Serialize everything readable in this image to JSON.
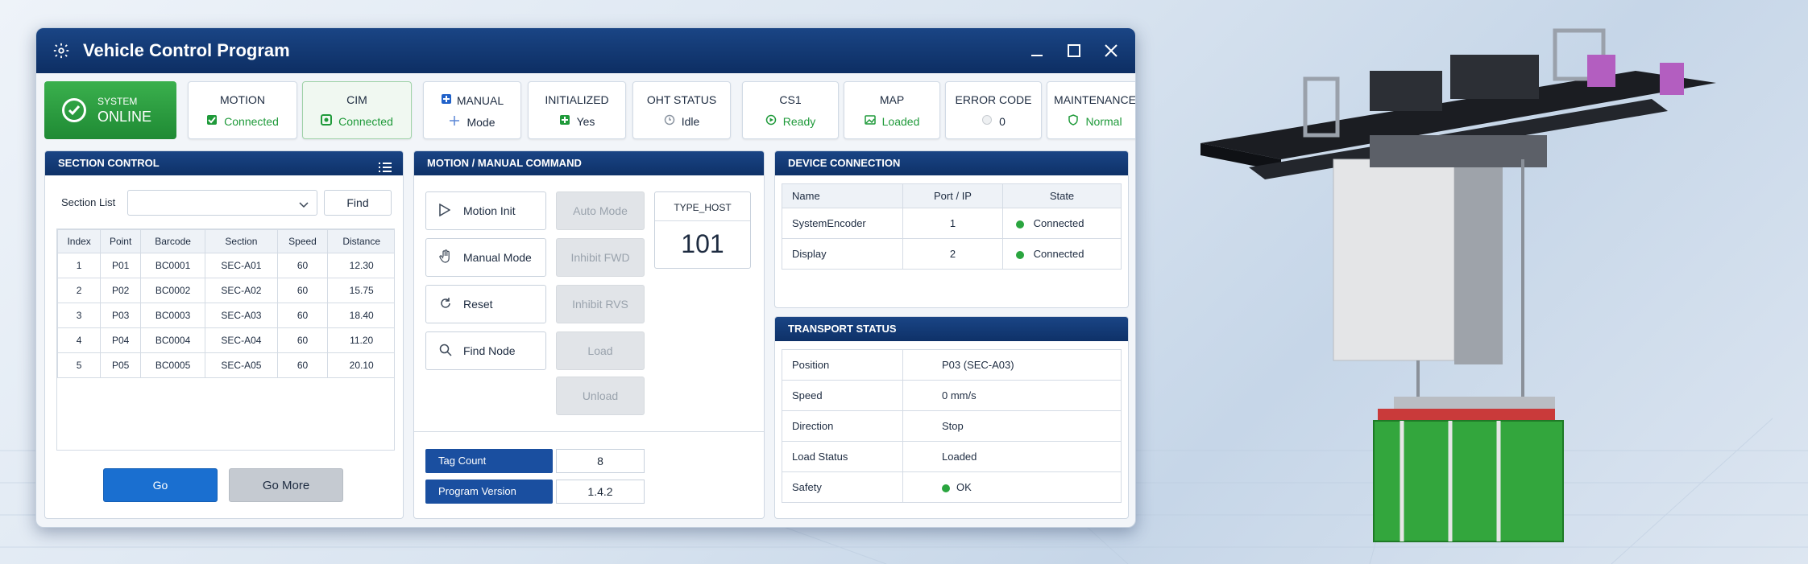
{
  "window": {
    "title": "Vehicle Control Program"
  },
  "system": {
    "label": "SYSTEM",
    "status": "ONLINE"
  },
  "tiles": [
    {
      "title": "MOTION",
      "value": "Connected",
      "icon": "check-square-icon"
    },
    {
      "title": "CIM",
      "value": "Connected",
      "icon": "check-square-icon"
    },
    {
      "title": "MANUAL",
      "value": "Mode",
      "icon": "move-icon"
    },
    {
      "title": "INITIALIZED",
      "value": "Yes",
      "icon": "check-square-icon"
    },
    {
      "title": "OHT STATUS",
      "value": "Idle",
      "icon": "clock-icon"
    },
    {
      "title": "CS1",
      "value": "Ready",
      "icon": "play-circle-icon"
    },
    {
      "title": "MAP",
      "value": "Loaded",
      "icon": "image-icon"
    },
    {
      "title": "ERROR CODE",
      "value": "0",
      "icon": "status-dot-icon"
    },
    {
      "title": "MAINTENANCE",
      "value": "Normal",
      "icon": "shield-icon"
    }
  ],
  "section_control": {
    "title": "SECTION CONTROL",
    "list_label": "Section List",
    "find_label": "Find",
    "columns": [
      "Index",
      "Point",
      "Barcode",
      "Section",
      "Speed",
      "Distance"
    ],
    "rows": [
      [
        "1",
        "P01",
        "BC0001",
        "SEC-A01",
        "60",
        "12.30"
      ],
      [
        "2",
        "P02",
        "BC0002",
        "SEC-A02",
        "60",
        "15.75"
      ],
      [
        "3",
        "P03",
        "BC0003",
        "SEC-A03",
        "60",
        "18.40"
      ],
      [
        "4",
        "P04",
        "BC0004",
        "SEC-A04",
        "60",
        "11.20"
      ],
      [
        "5",
        "P05",
        "BC0005",
        "SEC-A05",
        "60",
        "20.10"
      ]
    ],
    "go_label": "Go",
    "go_more_label": "Go More"
  },
  "motion": {
    "title": "MOTION / MANUAL COMMAND",
    "motion_init": "Motion Init",
    "manual_mode": "Manual Mode",
    "reset": "Reset",
    "find_node": "Find Node",
    "auto_mode": "Auto Mode",
    "inhibit_fwd": "Inhibit FWD",
    "inhibit_rvs": "Inhibit RVS",
    "load": "Load",
    "unload": "Unload",
    "type_host_label": "TYPE_HOST",
    "type_host_value": "101",
    "tag_count_label": "Tag Count",
    "tag_count_value": "8",
    "program_version_label": "Program Version",
    "program_version_value": "1.4.2"
  },
  "device": {
    "title": "DEVICE CONNECTION",
    "columns": [
      "Name",
      "Port / IP",
      "State"
    ],
    "rows": [
      {
        "name": "SystemEncoder",
        "port": "1",
        "state": "Connected"
      },
      {
        "name": "Display",
        "port": "2",
        "state": "Connected"
      }
    ]
  },
  "transport": {
    "title": "TRANSPORT STATUS",
    "rows": [
      {
        "label": "Position",
        "value": "P03 (SEC-A03)"
      },
      {
        "label": "Speed",
        "value": "0 mm/s"
      },
      {
        "label": "Direction",
        "value": "Stop"
      },
      {
        "label": "Load Status",
        "value": "Loaded"
      },
      {
        "label": "Safety",
        "value": "OK"
      }
    ]
  },
  "colors": {
    "accent": "#0e3168",
    "online": "#2aa53f",
    "button_blue": "#1a6fd0"
  }
}
